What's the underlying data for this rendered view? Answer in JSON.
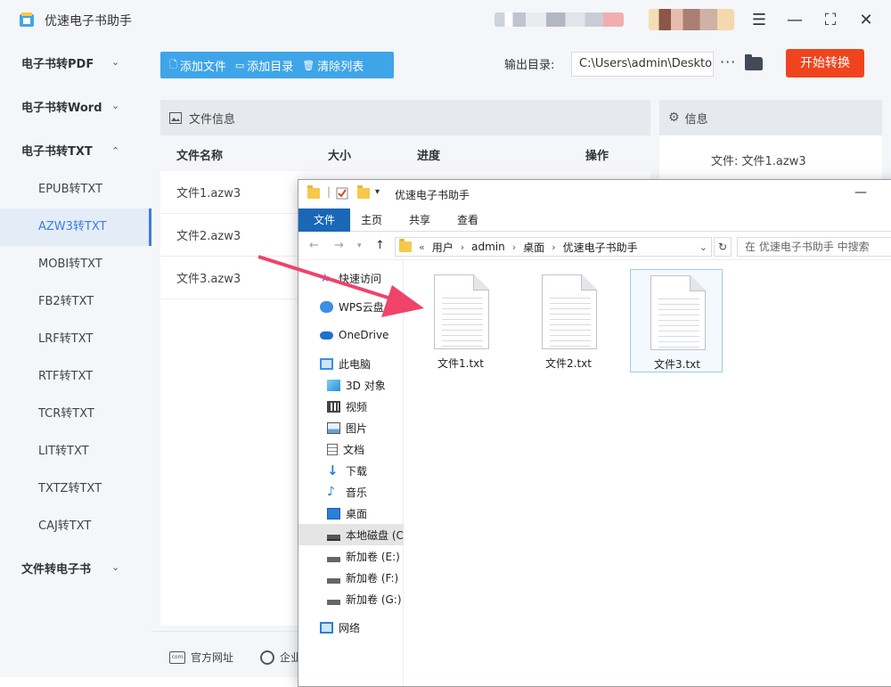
{
  "app": {
    "title": "优速电子书助手"
  },
  "sidebar": {
    "groups": [
      {
        "label": "电子书转PDF",
        "chevron": "chevron-down"
      },
      {
        "label": "电子书转Word",
        "chevron": "chevron-down"
      },
      {
        "label": "电子书转TXT",
        "chevron": "chevron-up"
      },
      {
        "label": "文件转电子书",
        "chevron": "chevron-down"
      }
    ],
    "items": [
      "EPUB转TXT",
      "AZW3转TXT",
      "MOBI转TXT",
      "FB2转TXT",
      "LRF转TXT",
      "RTF转TXT",
      "TCR转TXT",
      "LIT转TXT",
      "TXTZ转TXT",
      "CAJ转TXT"
    ],
    "active_item": "AZW3转TXT"
  },
  "toolbar": {
    "add_file": "添加文件",
    "add_dir": "添加目录",
    "clear_list": "清除列表"
  },
  "output": {
    "label": "输出目录:",
    "path": "C:\\Users\\admin\\Deskto",
    "more": "···",
    "start": "开始转换"
  },
  "file_panel": {
    "title": "文件信息",
    "columns": [
      "文件名称",
      "大小",
      "进度",
      "操作"
    ],
    "rows": [
      "文件1.azw3",
      "文件2.azw3",
      "文件3.azw3"
    ]
  },
  "info_panel": {
    "title": "信息",
    "file_line": "文件:  文件1.azw3"
  },
  "footer": {
    "website": "官方网址",
    "other": "企业"
  },
  "explorer": {
    "title": "优速电子书助手",
    "tabs": [
      "文件",
      "主页",
      "共享",
      "查看"
    ],
    "address": [
      "用户",
      "admin",
      "桌面",
      "优速电子书助手"
    ],
    "address_prefix": "«",
    "search_placeholder": "在 优速电子书助手 中搜索",
    "nav": [
      {
        "label": "快速访问",
        "icon": "star-icon"
      },
      {
        "label": "WPS云盘",
        "icon": "cloud-icon"
      },
      {
        "label": "OneDrive",
        "icon": "onedrive-icon"
      },
      {
        "label": "此电脑",
        "icon": "computer-icon"
      },
      {
        "label": "3D 对象",
        "icon": "cube-icon"
      },
      {
        "label": "视频",
        "icon": "video-icon"
      },
      {
        "label": "图片",
        "icon": "picture-icon"
      },
      {
        "label": "文档",
        "icon": "document-icon"
      },
      {
        "label": "下载",
        "icon": "download-icon"
      },
      {
        "label": "音乐",
        "icon": "music-icon"
      },
      {
        "label": "桌面",
        "icon": "desktop-icon"
      },
      {
        "label": "本地磁盘 (C:)",
        "icon": "drive-c-icon"
      },
      {
        "label": "新加卷 (E:)",
        "icon": "drive-icon"
      },
      {
        "label": "新加卷 (F:)",
        "icon": "drive-icon"
      },
      {
        "label": "新加卷 (G:)",
        "icon": "drive-icon"
      },
      {
        "label": "网络",
        "icon": "network-icon"
      }
    ],
    "selected_nav": "本地磁盘 (C:)",
    "files": [
      "文件1.txt",
      "文件2.txt",
      "文件3.txt"
    ],
    "selected_file": "文件3.txt"
  },
  "colors": {
    "accent": "#3fa5e9",
    "start": "#f0441e",
    "active": "#3a7fdc",
    "arrow": "#f0436a"
  }
}
